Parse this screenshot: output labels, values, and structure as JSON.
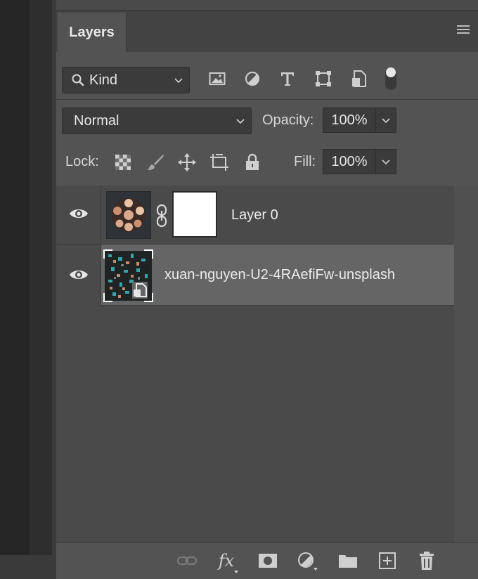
{
  "panel": {
    "tab_label": "Layers"
  },
  "filter": {
    "kind_label": "Kind",
    "icons": [
      "image-filter-icon",
      "adjustment-filter-icon",
      "type-filter-icon",
      "shape-filter-icon",
      "smart-object-filter-icon",
      "filter-toggle-icon"
    ]
  },
  "blend": {
    "mode": "Normal",
    "opacity_label": "Opacity:",
    "opacity_value": "100%"
  },
  "lock": {
    "label": "Lock:",
    "icons": [
      "lock-transparent-pixels-icon",
      "lock-image-pixels-icon",
      "lock-position-icon",
      "lock-artboard-icon",
      "lock-all-icon"
    ],
    "fill_label": "Fill:",
    "fill_value": "100%"
  },
  "layers": [
    {
      "name": "Layer 0",
      "visible": true,
      "selected": false,
      "has_mask": true
    },
    {
      "name": "xuan-nguyen-U2-4RAefiFw-unsplash",
      "visible": true,
      "selected": true,
      "smart_object": true
    }
  ],
  "bottom_bar": {
    "icons": [
      "link-layers-icon",
      "fx-icon",
      "add-mask-icon",
      "adjustment-layer-icon",
      "group-folder-icon",
      "new-layer-icon",
      "delete-layer-icon"
    ],
    "fx_label": "fx"
  },
  "colors": {
    "panel_bg": "#535353",
    "selected_row": "#656565",
    "field_bg": "#3b3b3b"
  }
}
